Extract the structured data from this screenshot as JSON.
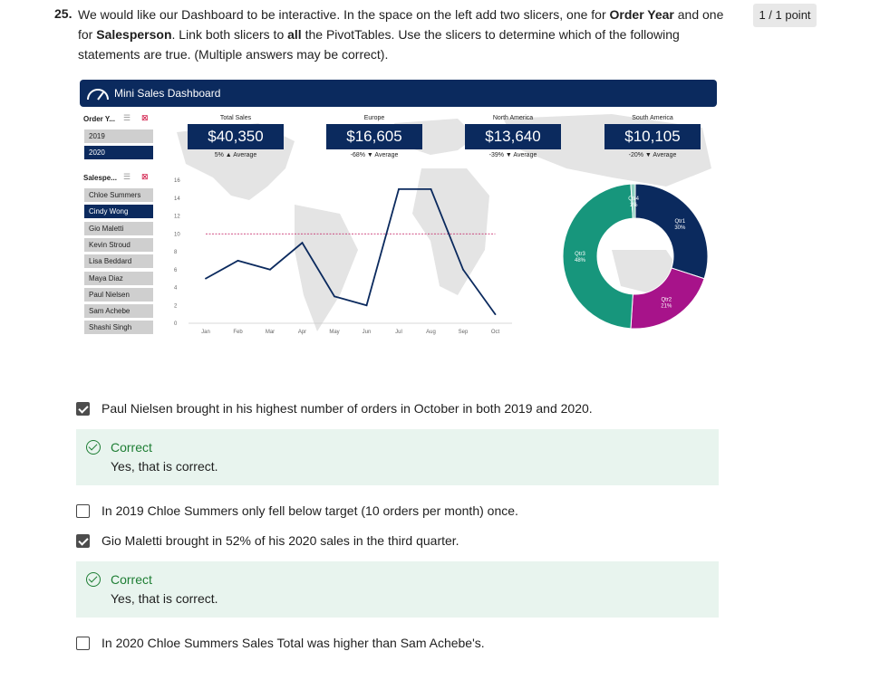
{
  "question": {
    "number": "25.",
    "text_parts": {
      "p1": "We would like our Dashboard to be interactive. In the space on the left add two slicers, one for ",
      "b1": "Order Year",
      "p2": " and one for ",
      "b2": "Salesperson",
      "p3": ". Link both slicers to ",
      "b3": "all",
      "p4": " the PivotTables. Use the slicers to determine which of the following statements are true. (Multiple answers may be correct)."
    },
    "points": "1 / 1 point"
  },
  "dashboard": {
    "title": "Mini Sales Dashboard",
    "colors": {
      "navy": "#0b2a5e",
      "teal": "#17967c",
      "magenta": "#a7138a",
      "slicer_gray": "#cfcfcf",
      "target_line": "#c0175d",
      "map_gray": "#e4e4e4"
    },
    "slicer_year": {
      "title": "Order Y...",
      "items": [
        {
          "label": "2019",
          "selected": false
        },
        {
          "label": "2020",
          "selected": true
        }
      ]
    },
    "slicer_salesperson": {
      "title": "Salespe...",
      "items": [
        {
          "label": "Chloe Summers",
          "selected": false
        },
        {
          "label": "Cindy Wong",
          "selected": true
        },
        {
          "label": "Gio Maletti",
          "selected": false
        },
        {
          "label": "Kevin Stroud",
          "selected": false
        },
        {
          "label": "Lisa Beddard",
          "selected": false
        },
        {
          "label": "Maya Diaz",
          "selected": false
        },
        {
          "label": "Paul Nielsen",
          "selected": false
        },
        {
          "label": "Sam Achebe",
          "selected": false
        },
        {
          "label": "Shashi Singh",
          "selected": false
        }
      ]
    },
    "kpis": [
      {
        "label": "Total Sales",
        "value": "$40,350",
        "sub": "5% ▲ Average"
      },
      {
        "label": "Europe",
        "value": "$16,605",
        "sub": "-68% ▼ Average"
      },
      {
        "label": "North America",
        "value": "$13,640",
        "sub": "-39% ▼ Average"
      },
      {
        "label": "South America",
        "value": "$10,105",
        "sub": "-20% ▼ Average"
      }
    ]
  },
  "chart_data": [
    {
      "type": "line",
      "categories": [
        "Jan",
        "Feb",
        "Mar",
        "Apr",
        "May",
        "Jun",
        "Jul",
        "Aug",
        "Sep",
        "Oct"
      ],
      "values": [
        5,
        7,
        6,
        9,
        3,
        2,
        15,
        15,
        6,
        1
      ],
      "target": 10,
      "yticks": [
        "0",
        "2",
        "4",
        "6",
        "8",
        "10",
        "12",
        "14",
        "16"
      ],
      "ylim": [
        0,
        16
      ],
      "grid": false
    },
    {
      "type": "pie",
      "donut": true,
      "slices": [
        {
          "label": "Qtr1",
          "pct_label": "30%",
          "value": 30,
          "color": "#0b2a5e"
        },
        {
          "label": "Qtr2",
          "pct_label": "21%",
          "value": 21,
          "color": "#a7138a"
        },
        {
          "label": "Qtr3",
          "pct_label": "48%",
          "value": 48,
          "color": "#17967c"
        },
        {
          "label": "Qtr4",
          "pct_label": "1%",
          "value": 1,
          "color": "#8fd0c0"
        }
      ]
    }
  ],
  "options": [
    {
      "text": "Paul Nielsen brought in his highest number of orders in October in both 2019 and 2020.",
      "checked": true,
      "feedback": {
        "title": "Correct",
        "text": "Yes, that is correct."
      }
    },
    {
      "text": "In 2019 Chloe Summers only fell below target (10 orders per month) once.",
      "checked": false
    },
    {
      "text": "Gio Maletti brought in 52% of his 2020 sales in the third quarter.",
      "checked": true,
      "feedback": {
        "title": "Correct",
        "text": "Yes, that is correct."
      }
    },
    {
      "text": "In 2020 Chloe Summers Sales Total was higher than Sam Achebe's.",
      "checked": false
    }
  ]
}
